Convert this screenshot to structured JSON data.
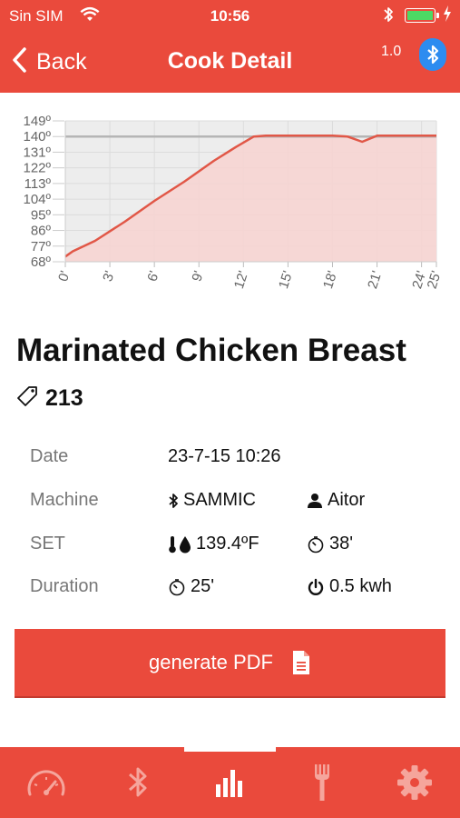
{
  "status_bar": {
    "carrier": "Sin SIM",
    "time": "10:56"
  },
  "nav": {
    "back_label": "Back",
    "title": "Cook Detail",
    "version": "1.0"
  },
  "chart_data": {
    "type": "area",
    "y_ticks": [
      "149º",
      "140º",
      "131º",
      "122º",
      "113º",
      "104º",
      "95º",
      "86º",
      "77º",
      "68º"
    ],
    "x_ticks": [
      "0'",
      "3'",
      "6'",
      "9'",
      "12'",
      "15'",
      "18'",
      "21'",
      "24'",
      "25'"
    ],
    "x_tick_values": [
      0,
      3,
      6,
      9,
      12,
      15,
      18,
      21,
      24,
      25
    ],
    "ylim": [
      68,
      149
    ],
    "xlim": [
      0,
      25
    ],
    "set_line": 140,
    "x": [
      0,
      0.5,
      2,
      4,
      6,
      8,
      10,
      11.5,
      12.7,
      13.5,
      18,
      19,
      20,
      21,
      25
    ],
    "y": [
      71,
      74,
      80,
      91,
      103,
      114,
      126,
      134,
      140,
      140.5,
      140.5,
      140,
      137,
      140.5,
      140.5
    ],
    "grid": true,
    "line_color": "#e15747",
    "fill_color": "#f6d4d1",
    "set_line_color": "#b5b5b5"
  },
  "cook": {
    "name": "Marinated Chicken Breast",
    "id": "213",
    "labels": {
      "date": "Date",
      "machine": "Machine",
      "set": "SET",
      "duration": "Duration"
    },
    "date": "23-7-15 10:26",
    "machine": "SAMMIC",
    "user": "Aitor",
    "set_temp": "139.4ºF",
    "set_time": "38'",
    "duration": "25'",
    "energy": "0.5 kwh"
  },
  "pdf_button": {
    "label": "generate PDF"
  },
  "tabs": [
    {
      "icon": "gauge-icon",
      "active": false
    },
    {
      "icon": "bluetooth-icon",
      "active": false
    },
    {
      "icon": "bar-chart-icon",
      "active": true
    },
    {
      "icon": "fork-icon",
      "active": false
    },
    {
      "icon": "gear-icon",
      "active": false
    }
  ],
  "colors": {
    "brand": "#ea4a3c",
    "bluetooth": "#2d8cf0",
    "battery": "#4cd964",
    "tab_inactive": "#f5a59c"
  }
}
